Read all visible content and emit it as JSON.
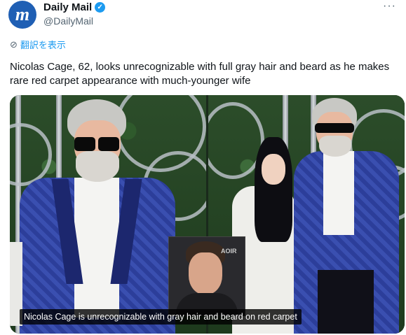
{
  "author": {
    "avatar_letter": "m",
    "display_name": "Daily Mail",
    "handle": "@DailyMail",
    "verified_mark": "✓"
  },
  "more_icon": "···",
  "translate": {
    "icon": "globe-icon",
    "label": "翻訳を表示"
  },
  "tweet": {
    "text": "Nicolas Cage, 62, looks unrecognizable with full gray hair and beard as he makes rare red carpet appearance with much-younger wife"
  },
  "media": {
    "inset_brand": "AOIR",
    "caption": "Nicolas Cage is unrecognizable with gray hair and beard on red carpet"
  },
  "colors": {
    "accent": "#1d9bf0",
    "brand": "#1f5fb4",
    "text": "#0f1419",
    "muted": "#536471"
  }
}
